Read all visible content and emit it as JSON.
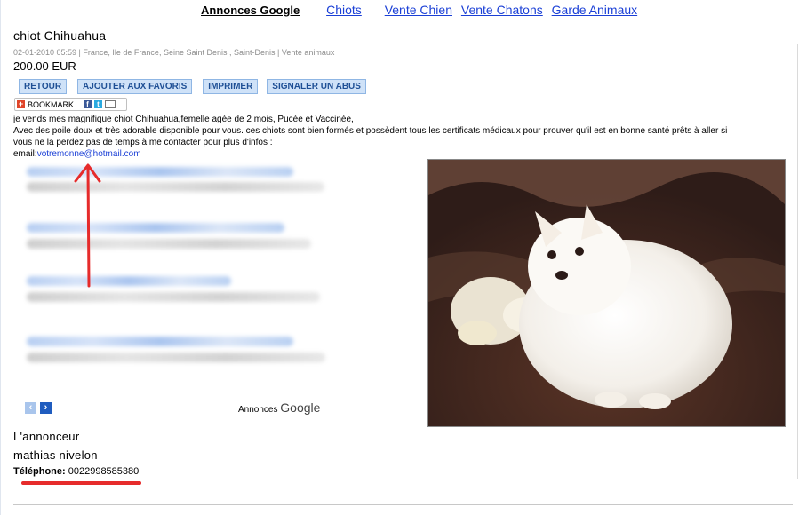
{
  "nav": {
    "google_ads_label": "Annonces Google",
    "links": [
      "Chiots",
      "Vente Chien",
      "Vente Chatons",
      "Garde Animaux"
    ]
  },
  "listing": {
    "title": "chiot Chihuahua",
    "meta": "02-01-2010 05:59 | France, Ile de France, Seine Saint Denis , Saint-Denis | Vente animaux",
    "price": "200.00 EUR"
  },
  "buttons": {
    "back": "RETOUR",
    "favorite": "AJOUTER AUX FAVORIS",
    "print": "IMPRIMER",
    "report": "SIGNALER UN ABUS"
  },
  "share": {
    "bookmark_label": "BOOKMARK",
    "more": "..."
  },
  "description": {
    "line1": "je vends mes magnifique chiot Chihuahua,femelle agée de 2 mois, Pucée et Vaccinée,",
    "line2": "Avec des poile doux et très adorable disponible pour vous. ces chiots sont bien formés et possèdent tous les certificats médicaux pour prouver qu'il est en bonne santé prêts à aller si",
    "line3": "vous ne la perdez pas de temps à me contacter pour plus d'infos :",
    "email_prefix": "email:",
    "email": "votremonne@hotmail.com"
  },
  "ads": {
    "label": "Annonces",
    "brand": "Google",
    "prev_icon": "chevron-left-icon",
    "next_icon": "chevron-right-icon"
  },
  "advertiser": {
    "heading": "L'annonceur",
    "name": "mathias nivelon",
    "phone_label": "Téléphone:",
    "phone": "0022998585380"
  },
  "colors": {
    "link": "#1a3fd6",
    "button_bg": "#cfe2f8",
    "button_text": "#1e4f95",
    "annotation_red": "#e62b2b"
  }
}
